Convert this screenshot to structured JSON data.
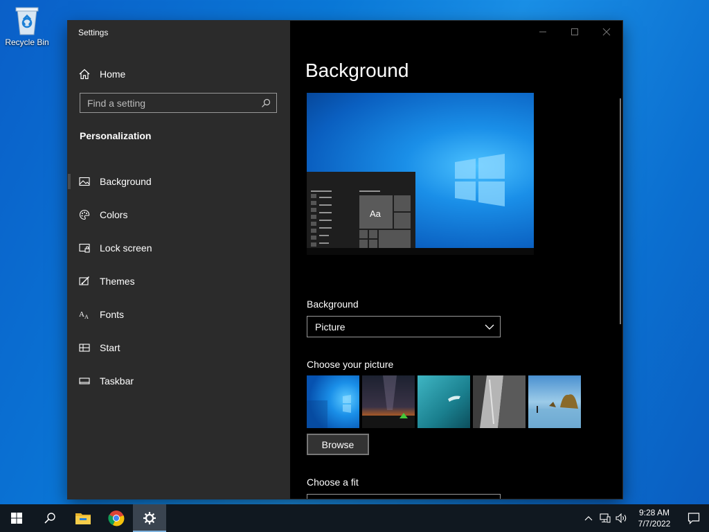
{
  "desktop": {
    "recycle_bin_label": "Recycle Bin"
  },
  "window": {
    "title": "Settings"
  },
  "sidebar": {
    "home_label": "Home",
    "search_placeholder": "Find a setting",
    "section_title": "Personalization",
    "items": [
      {
        "label": "Background",
        "icon": "picture-icon",
        "active": true
      },
      {
        "label": "Colors",
        "icon": "palette-icon"
      },
      {
        "label": "Lock screen",
        "icon": "lock-screen-icon"
      },
      {
        "label": "Themes",
        "icon": "themes-icon"
      },
      {
        "label": "Fonts",
        "icon": "fonts-icon"
      },
      {
        "label": "Start",
        "icon": "start-icon"
      },
      {
        "label": "Taskbar",
        "icon": "taskbar-icon"
      }
    ]
  },
  "content": {
    "page_title": "Background",
    "preview_sample_text": "Aa",
    "background_label": "Background",
    "background_value": "Picture",
    "choose_picture_label": "Choose your picture",
    "browse_label": "Browse",
    "choose_fit_label": "Choose a fit"
  },
  "taskbar": {
    "items": [
      "start-icon",
      "search-icon",
      "file-explorer-icon",
      "chrome-icon",
      "settings-icon"
    ],
    "active": "settings-icon",
    "clock_time": "9:28 AM",
    "clock_date": "7/7/2022"
  },
  "colors": {
    "accent": "#0a78d7",
    "sidebar_bg": "#2b2b2b",
    "content_bg": "#000000",
    "taskbar_bg": "#101820"
  }
}
